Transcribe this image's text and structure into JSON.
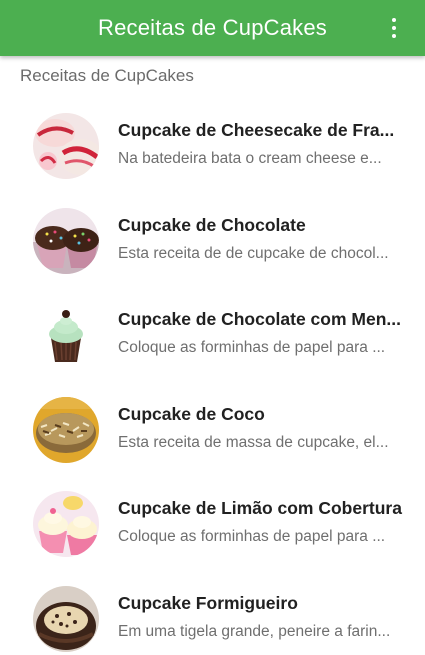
{
  "app_bar": {
    "title": "Receitas de CupCakes",
    "menu_icon": "more-vert-icon",
    "color": "#4caf50"
  },
  "section_header": "Receitas de CupCakes",
  "recipes": [
    {
      "title": "Cupcake de Cheesecake de Fra...",
      "subtitle": "Na batedeira bata o cream cheese e...",
      "image": "cupcake-cheesecake-strawberry-photo"
    },
    {
      "title": "Cupcake de Chocolate",
      "subtitle": "Esta receita de de cupcake de chocol...",
      "image": "cupcake-chocolate-sprinkles-photo"
    },
    {
      "title": "Cupcake de Chocolate com Men...",
      "subtitle": "Coloque as forminhas de papel para ...",
      "image": "cupcake-chocolate-mint-photo"
    },
    {
      "title": "Cupcake de Coco",
      "subtitle": "Esta receita de massa de cupcake, el...",
      "image": "cupcake-coconut-photo"
    },
    {
      "title": "Cupcake de Limão com Cobertura",
      "subtitle": "Coloque as forminhas de papel para ...",
      "image": "cupcake-lemon-frosting-photo"
    },
    {
      "title": "Cupcake Formigueiro",
      "subtitle": "Em uma tigela grande, peneire a farin...",
      "image": "cupcake-formigueiro-photo"
    }
  ]
}
